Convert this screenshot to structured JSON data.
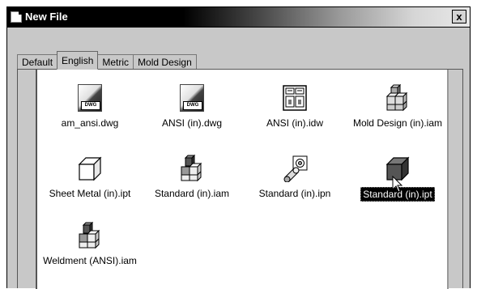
{
  "window": {
    "title": "New File",
    "close_label": "x"
  },
  "tabs": [
    {
      "label": "Default"
    },
    {
      "label": "English"
    },
    {
      "label": "Metric"
    },
    {
      "label": "Mold Design"
    }
  ],
  "active_tab": "English",
  "templates": [
    {
      "label": "am_ansi.dwg",
      "icon": "dwg-file-icon"
    },
    {
      "label": "ANSI (in).dwg",
      "icon": "dwg-file-icon"
    },
    {
      "label": "ANSI (in).idw",
      "icon": "drawing-sheet-icon"
    },
    {
      "label": "Mold Design (in).iam",
      "icon": "assembly-icon"
    },
    {
      "label": "Sheet Metal (in).ipt",
      "icon": "sheet-metal-part-icon"
    },
    {
      "label": "Standard (in).iam",
      "icon": "assembly-icon"
    },
    {
      "label": "Standard (in).ipn",
      "icon": "presentation-icon"
    },
    {
      "label": "Standard (in).ipt",
      "icon": "part-icon",
      "selected": true
    },
    {
      "label": "Weldment (ANSI).iam",
      "icon": "weldment-assembly-icon"
    }
  ],
  "dwg_badge": "DWG"
}
